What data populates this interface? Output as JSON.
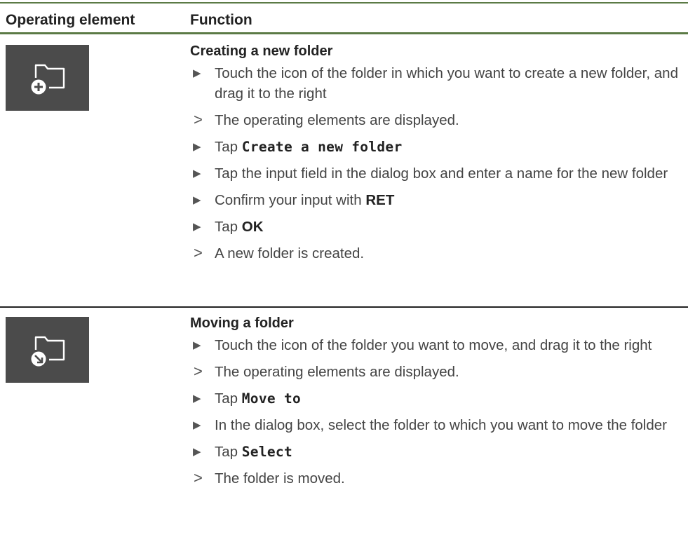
{
  "table": {
    "header": {
      "col1": "Operating element",
      "col2": "Function"
    },
    "rows": [
      {
        "icon": "folder-add-icon",
        "title": "Creating a new folder",
        "steps": [
          {
            "type": "instruction",
            "text": "Touch the icon of the folder in which you want to create a new folder, and drag it to the right"
          },
          {
            "type": "result",
            "text": "The operating elements are displayed."
          },
          {
            "type": "instruction",
            "prefix": "Tap ",
            "strong": "Create a new folder",
            "strong_style": "mono"
          },
          {
            "type": "instruction",
            "text": "Tap the input field in the dialog box and enter a name for the new folder"
          },
          {
            "type": "instruction",
            "prefix": "Confirm your input with ",
            "strong": "RET",
            "strong_style": "bold"
          },
          {
            "type": "instruction",
            "prefix": "Tap ",
            "strong": "OK",
            "strong_style": "bold"
          },
          {
            "type": "result",
            "text": "A new folder is created."
          }
        ]
      },
      {
        "icon": "folder-move-icon",
        "title": "Moving a folder",
        "steps": [
          {
            "type": "instruction",
            "text": "Touch the icon of the folder you want to move, and drag it to the right"
          },
          {
            "type": "result",
            "text": "The operating elements are displayed."
          },
          {
            "type": "instruction",
            "prefix": "Tap ",
            "strong": "Move to",
            "strong_style": "mono"
          },
          {
            "type": "instruction",
            "text": "In the dialog box, select the folder to which you want to move the folder"
          },
          {
            "type": "instruction",
            "prefix": "Tap ",
            "strong": "Select",
            "strong_style": "mono"
          },
          {
            "type": "result",
            "text": "The folder is moved."
          }
        ]
      }
    ],
    "markers": {
      "instruction": "▶",
      "result": ">"
    },
    "colors": {
      "rule_accent": "#5b7a45",
      "icon_bg": "#4b4b4b",
      "icon_fg": "#ffffff"
    }
  }
}
